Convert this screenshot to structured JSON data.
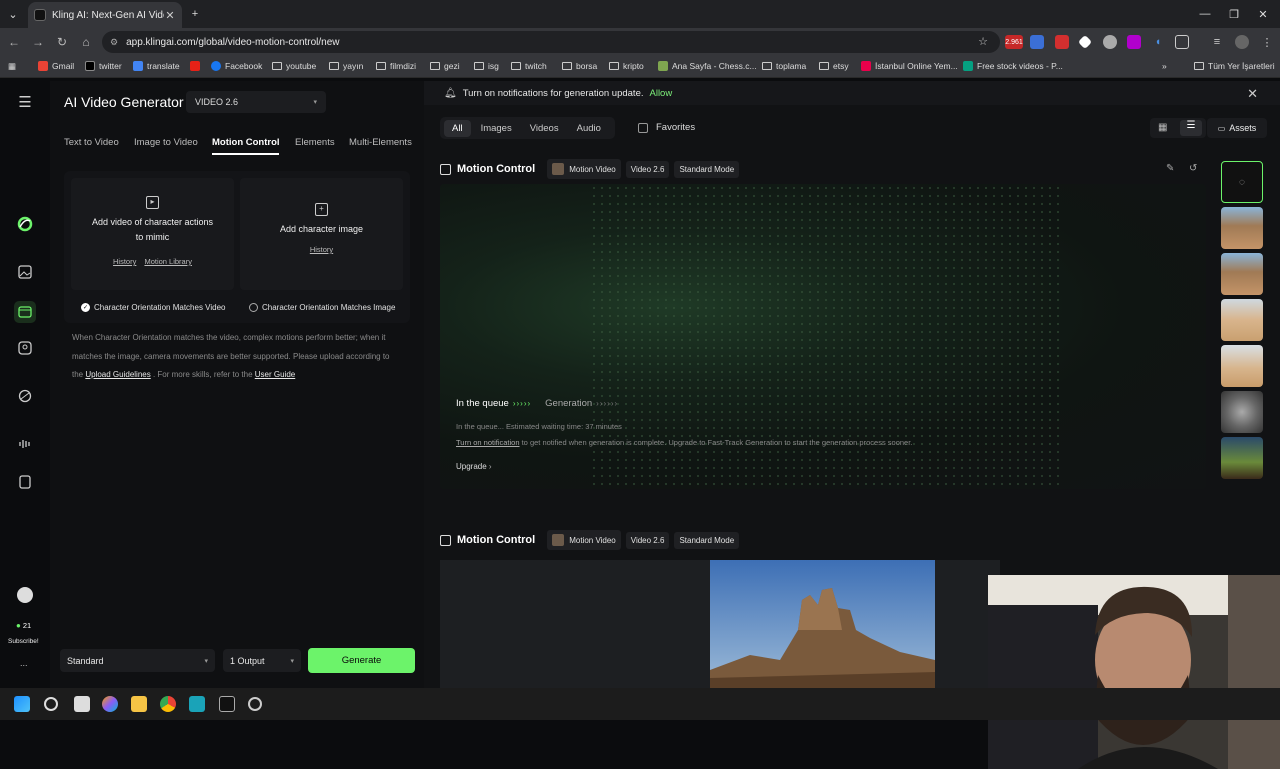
{
  "browser": {
    "tab_title": "Kling AI: Next-Gen AI Video & A",
    "url": "app.klingai.com/global/video-motion-control/new",
    "bookmarks": [
      "Gmail",
      "twitter",
      "translate",
      "Facebook",
      "youtube",
      "yayın",
      "filmdizi",
      "gezi",
      "isg",
      "twitch",
      "borsa",
      "kripto",
      "Ana Sayfa - Chess.c...",
      "toplama",
      "etsy",
      "İstanbul Online Yem...",
      "Free stock videos - P...",
      "Tüm Yer İşaretleri"
    ],
    "ext_badge": "2.961"
  },
  "sidebar": {
    "credits": "21",
    "subscribe": "Subscribe!",
    "more": "..."
  },
  "left": {
    "title": "AI Video Generator",
    "model": "VIDEO 2.6",
    "tabs": [
      "Text to Video",
      "Image to Video",
      "Motion Control",
      "Elements",
      "Multi-Elements"
    ],
    "video_card_label": "Add video of character actions to mimic",
    "video_card_history": "History",
    "video_card_library": "Motion Library",
    "image_card_label": "Add character image",
    "image_card_history": "History",
    "option1": "Character Orientation Matches Video",
    "option2": "Character Orientation Matches Image",
    "help_part1": "When Character Orientation matches the video, complex motions perform better; when it matches the image, camera movements are better supported. Please upload according to the ",
    "help_link1": "Upload Guidelines",
    "help_part2": " . For more skills, refer to the ",
    "help_link2": "User Guide",
    "quality": "Standard",
    "outputs": "1 Output",
    "generate": "Generate"
  },
  "right": {
    "notification": "Turn on notifications for generation update.",
    "allow": "Allow",
    "filters": [
      "All",
      "Images",
      "Videos",
      "Audio"
    ],
    "favorites": "Favorites",
    "assets": "Assets",
    "card_title": "Motion Control",
    "chip_motion": "Motion Video",
    "chip_model": "Video 2.6",
    "chip_mode": "Standard Mode",
    "queue_label": "In the queue",
    "generation_label": "Generation",
    "wait_text": "In the queue... Estimated waiting time: 37 minutes",
    "notify_link": "Turn on notification",
    "notify_rest": " to get notified when generation is complete. Upgrade to Fast-Track Generation to start the generation process sooner.",
    "upgrade": "Upgrade"
  },
  "colors": {
    "accent": "#6cf36a",
    "background": "#0b0c0e"
  }
}
